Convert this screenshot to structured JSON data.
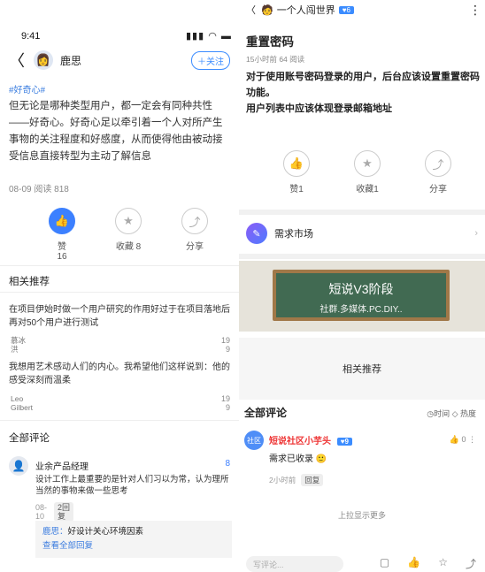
{
  "left": {
    "status_time": "9:41",
    "status_icons": "▮▮▮ ◠ ▬",
    "header": {
      "author": "鹿思",
      "follow": "＋关注"
    },
    "tag": "#好奇心#",
    "paragraph": "但无论是哪种类型用户，都一定会有同种共性——好奇心。好奇心足以牵引着一个人对所产生事物的关注程度和好感度，从而使得他由被动接受信息直接转型为主动了解信息",
    "meta": "08-09 阅读 818",
    "actions": [
      {
        "label": "赞",
        "count": "16"
      },
      {
        "label": "收藏 8",
        "count": ""
      },
      {
        "label": "分享",
        "count": ""
      }
    ],
    "related_title": "相关推荐",
    "related": [
      {
        "text": "在项目伊始时做一个用户研究的作用好过于在项目落地后再对50个用户进行测试",
        "author": "慕冰\n洪",
        "likes": "19\n9"
      },
      {
        "text": "我想用艺术感动人们的内心。我希望他们这样说到：他的感受深刻而温柔",
        "author": "Leo\nGilbert",
        "likes": "19\n9"
      }
    ],
    "comments_title": "全部评论",
    "comment": {
      "name": "业余产品经理",
      "likes": "8",
      "text": "设计工作上最重要的是针对人们习以为常，认为理所当然的事物来做一些思考",
      "date": "08-\n10",
      "reply_count": "2回\n复",
      "reply_author": "鹿思：",
      "reply_text": "好设计关心环境因素",
      "view_all": "查看全部回复"
    }
  },
  "right": {
    "header": {
      "back": "〈",
      "name": "一个人闯世界",
      "level": "♥6",
      "more": "⋮"
    },
    "title": "重置密码",
    "meta": "15小时前  64 阅读",
    "body": "对于使用账号密码登录的用户，后台应该设置重置密码功能。\n用户列表中应该体现登录邮箱地址",
    "actions": [
      {
        "label": "赞1"
      },
      {
        "label": "收藏1"
      },
      {
        "label": "分享"
      }
    ],
    "market": "需求市场",
    "banner": {
      "line1": "短说V3阶段",
      "line2": "社群.多媒体.PC.DIY.."
    },
    "related": "相关推荐",
    "comments_title": "全部评论",
    "sort": "◷时间  ◇ 热度",
    "comment": {
      "name": "短说社区小芋头",
      "level": "♥9",
      "likes": "0",
      "text": "需求已收录 🙂",
      "time": "2小时前",
      "reply": "回复"
    },
    "more": "上拉显示更多",
    "input_placeholder": "写评论..."
  }
}
